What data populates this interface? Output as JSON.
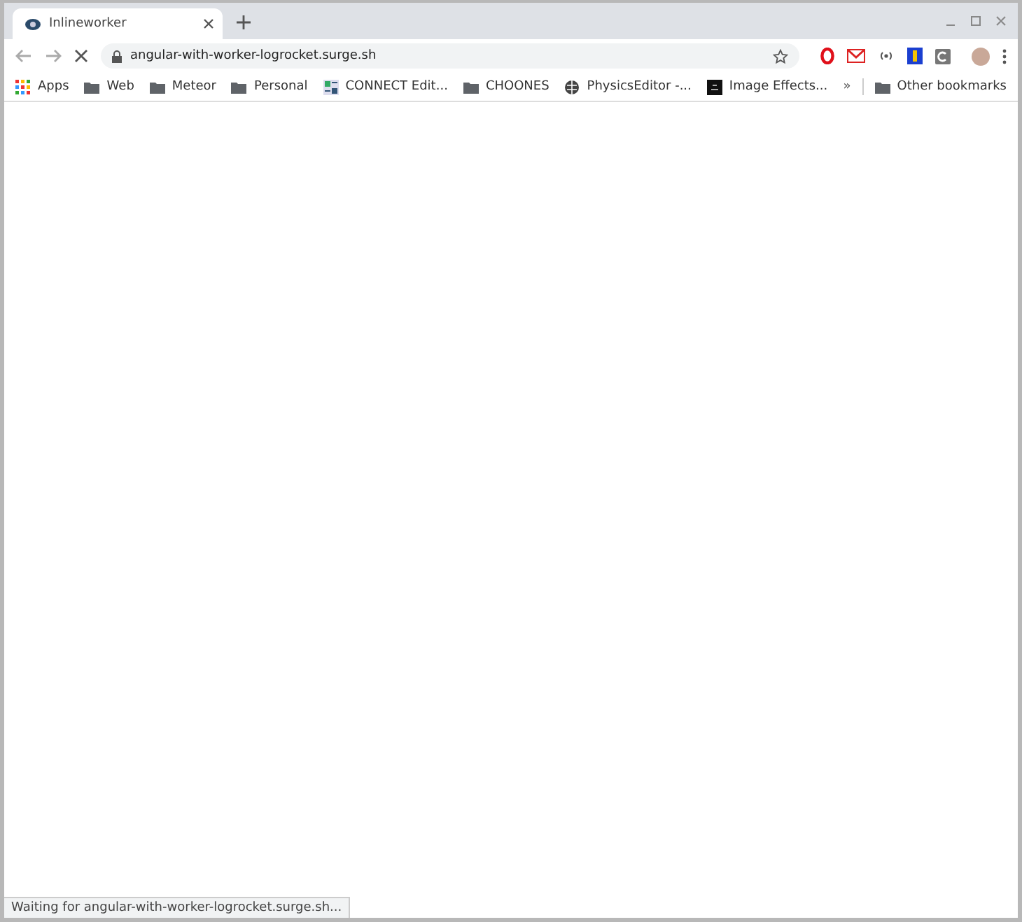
{
  "tabs": [
    {
      "title": "Inlineworker",
      "selected": true
    }
  ],
  "toolbar": {
    "address": "angular-with-worker-logrocket.surge.sh",
    "loading": true
  },
  "bookmarks": [
    {
      "label": "Apps",
      "kind": "apps"
    },
    {
      "label": "Web",
      "kind": "folder"
    },
    {
      "label": "Meteor",
      "kind": "folder"
    },
    {
      "label": "Personal",
      "kind": "folder"
    },
    {
      "label": "CONNECT Edit...",
      "kind": "page"
    },
    {
      "label": "CHOONES",
      "kind": "folder"
    },
    {
      "label": "PhysicsEditor -...",
      "kind": "globe"
    },
    {
      "label": "Image Effects...",
      "kind": "dark"
    }
  ],
  "overflow": "»",
  "other_bookmarks": {
    "label": "Other bookmarks",
    "kind": "folder"
  },
  "status_bar": "Waiting for angular-with-worker-logrocket.surge.sh..."
}
